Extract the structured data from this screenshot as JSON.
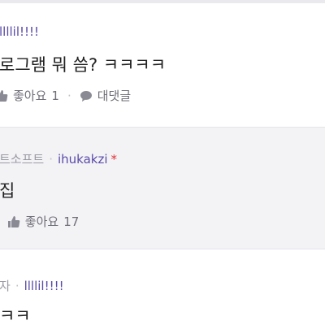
{
  "comments": [
    {
      "nickname": "llllil!!!!",
      "body": "로그램 뭐 씀? ㅋㅋㅋㅋ",
      "like_label": "좋아요",
      "like_count": "1",
      "reply_label": "대댓글"
    },
    {
      "meta": "트소프트",
      "nickname": "ihukakzi",
      "star": "*",
      "body": "집",
      "like_label": "좋아요",
      "like_count": "17"
    },
    {
      "meta": "자",
      "nickname": "llllil!!!!",
      "body": "ㅋㅋ"
    }
  ],
  "icons": {
    "like": "thumbs-up-icon",
    "reply": "speech-bubble-icon"
  },
  "colors": {
    "nickname": "#5a4aa8",
    "star": "#e0333a",
    "highlight_background": "#f3f3f6"
  }
}
